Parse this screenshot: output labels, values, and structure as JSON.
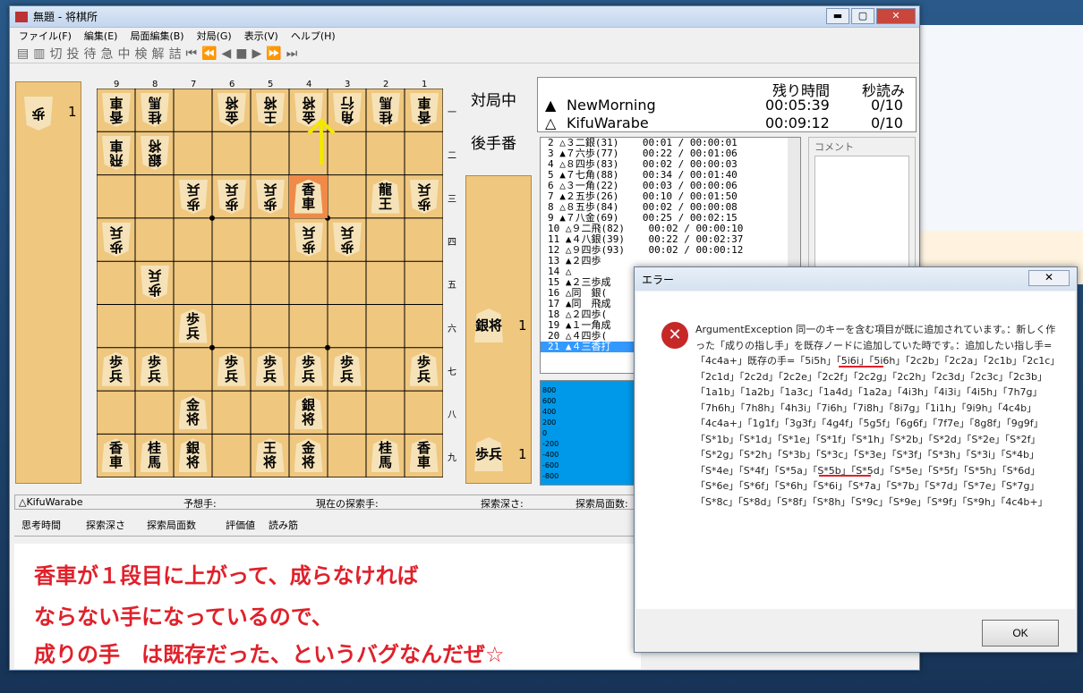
{
  "window": {
    "title": "無題 - 将棋所",
    "minimize": "▬",
    "maximize": "▢",
    "close": "✕"
  },
  "menu": [
    "ファイル(F)",
    "編集(E)",
    "局面編集(B)",
    "対局(G)",
    "表示(V)",
    "ヘルプ(H)"
  ],
  "toolbar": [
    "切",
    "投",
    "待",
    "急",
    "中",
    "検",
    "解",
    "詰",
    "⏮",
    "⏪",
    "◀",
    "■",
    "▶",
    "⏩",
    "⏭"
  ],
  "status_right": {
    "line1": "対局中",
    "line2": "後手番"
  },
  "gote_hand": [
    {
      "piece": "歩",
      "count": "1"
    }
  ],
  "sente_hand": [
    {
      "piece": "銀将",
      "count": "1"
    },
    {
      "piece": "歩兵",
      "count": "1"
    }
  ],
  "files": [
    "9",
    "8",
    "7",
    "6",
    "5",
    "4",
    "3",
    "2",
    "1"
  ],
  "ranks": [
    "一",
    "二",
    "三",
    "四",
    "五",
    "六",
    "七",
    "八",
    "九"
  ],
  "pieces": [
    {
      "c": 9,
      "r": 1,
      "t": "香車",
      "g": true
    },
    {
      "c": 8,
      "r": 1,
      "t": "桂馬",
      "g": true
    },
    {
      "c": 6,
      "r": 1,
      "t": "金将",
      "g": true
    },
    {
      "c": 5,
      "r": 1,
      "t": "王将",
      "g": true
    },
    {
      "c": 4,
      "r": 1,
      "t": "金将",
      "g": true
    },
    {
      "c": 3,
      "r": 1,
      "t": "角行",
      "g": true
    },
    {
      "c": 2,
      "r": 1,
      "t": "桂馬",
      "g": true
    },
    {
      "c": 1,
      "r": 1,
      "t": "香車",
      "g": true
    },
    {
      "c": 9,
      "r": 2,
      "t": "飛車",
      "g": true
    },
    {
      "c": 8,
      "r": 2,
      "t": "銀将",
      "g": true
    },
    {
      "c": 7,
      "r": 3,
      "t": "歩兵",
      "g": true
    },
    {
      "c": 6,
      "r": 3,
      "t": "歩兵",
      "g": true
    },
    {
      "c": 5,
      "r": 3,
      "t": "歩兵",
      "g": true
    },
    {
      "c": 4,
      "r": 3,
      "t": "香車",
      "g": false,
      "hl": true
    },
    {
      "c": 2,
      "r": 3,
      "t": "龍王",
      "g": false
    },
    {
      "c": 1,
      "r": 3,
      "t": "歩兵",
      "g": true
    },
    {
      "c": 9,
      "r": 4,
      "t": "歩兵",
      "g": true
    },
    {
      "c": 4,
      "r": 4,
      "t": "歩兵",
      "g": true
    },
    {
      "c": 3,
      "r": 4,
      "t": "歩兵",
      "g": true
    },
    {
      "c": 8,
      "r": 5,
      "t": "歩兵",
      "g": true
    },
    {
      "c": 7,
      "r": 6,
      "t": "歩兵",
      "g": false
    },
    {
      "c": 9,
      "r": 7,
      "t": "歩兵",
      "g": false
    },
    {
      "c": 8,
      "r": 7,
      "t": "歩兵",
      "g": false
    },
    {
      "c": 6,
      "r": 7,
      "t": "歩兵",
      "g": false
    },
    {
      "c": 5,
      "r": 7,
      "t": "歩兵",
      "g": false
    },
    {
      "c": 4,
      "r": 7,
      "t": "歩兵",
      "g": false
    },
    {
      "c": 3,
      "r": 7,
      "t": "歩兵",
      "g": false
    },
    {
      "c": 1,
      "r": 7,
      "t": "歩兵",
      "g": false
    },
    {
      "c": 7,
      "r": 8,
      "t": "金将",
      "g": false
    },
    {
      "c": 4,
      "r": 8,
      "t": "銀将",
      "g": false
    },
    {
      "c": 9,
      "r": 9,
      "t": "香車",
      "g": false
    },
    {
      "c": 8,
      "r": 9,
      "t": "桂馬",
      "g": false
    },
    {
      "c": 7,
      "r": 9,
      "t": "銀将",
      "g": false
    },
    {
      "c": 5,
      "r": 9,
      "t": "王将",
      "g": false
    },
    {
      "c": 4,
      "r": 9,
      "t": "金将",
      "g": false
    },
    {
      "c": 2,
      "r": 9,
      "t": "桂馬",
      "g": false
    },
    {
      "c": 1,
      "r": 9,
      "t": "香車",
      "g": false
    }
  ],
  "arrow_color": "#f2e800",
  "clock": {
    "h_remain": "残り時間",
    "h_byo": "秒読み",
    "p1": {
      "mark": "▲",
      "name": "NewMorning",
      "time": "00:05:39",
      "byo": "0/10"
    },
    "p2": {
      "mark": "△",
      "name": "KifuWarabe",
      "time": "00:09:12",
      "byo": "0/10"
    }
  },
  "kifu": [
    "2 △３二銀(31)    00:01 / 00:00:01",
    "3 ▲７六歩(77)    00:22 / 00:01:06",
    "4 △８四歩(83)    00:02 / 00:00:03",
    "5 ▲７七角(88)    00:34 / 00:01:40",
    "6 △３一角(22)    00:03 / 00:00:06",
    "7 ▲２五歩(26)    00:10 / 00:01:50",
    "8 △８五歩(84)    00:02 / 00:00:08",
    "9 ▲７八金(69)    00:25 / 00:02:15",
    "10 △９二飛(82)    00:02 / 00:00:10",
    "11 ▲４八銀(39)    00:22 / 00:02:37",
    "12 △９四歩(93)    00:02 / 00:00:12",
    "13 ▲２四歩",
    "14 △",
    "15 ▲２三歩成",
    "16 △同　銀(",
    "17 ▲同　飛成",
    "18 △２四歩(",
    "19 ▲１一角成",
    "20 △４四歩(",
    "21 ▲４三香打"
  ],
  "comment_label": "コメント",
  "eval_ticks": [
    "800",
    "600",
    "400",
    "200",
    "0",
    "-200",
    "-400",
    "-600",
    "-800"
  ],
  "status": {
    "player": "△KifuWarabe",
    "yosou": "予想手:",
    "current": "現在の探索手:",
    "depth": "探索深さ:",
    "nodes": "探索局面数:"
  },
  "think": {
    "time": "思考時間",
    "depth": "探索深さ",
    "nodes": "探索局面数",
    "eval": "評価値",
    "pv": "読み筋"
  },
  "memo": [
    "香車が１段目に上がって、成らなければ",
    "ならない手になっているので、",
    "成りの手　は既存だった、というバグなんだぜ☆"
  ],
  "dialog": {
    "title": "エラー",
    "close": "✕",
    "message": "ArgumentException 同一のキーを含む項目が既に追加されています。：新しく作った「成りの指し手」を既存ノードに追加していた時です。：追加したい指し手=「4c4a+」既存の手=「5i5h」「5i6i」「5i6h」「2c2b」「2c2a」「2c1b」「2c1c」「2c1d」「2c2d」「2c2e」「2c2f」「2c2g」「2c2h」「2c3d」「2c3c」「2c3b」「1a1b」「1a2b」「1a3c」「1a4d」「1a2a」「4i3h」「4i3i」「4i5h」「7h7g」「7h6h」「7h8h」「4h3i」「7i6h」「7i8h」「8i7g」「1i1h」「9i9h」「4c4b」「4c4a+」「1g1f」「3g3f」「4g4f」「5g5f」「6g6f」「7f7e」「8g8f」「9g9f」「S*1b」「S*1d」「S*1e」「S*1f」「S*1h」「S*2b」「S*2d」「S*2e」「S*2f」「S*2g」「S*2h」「S*3b」「S*3c」「S*3e」「S*3f」「S*3h」「S*3i」「S*4b」「S*4e」「S*4f」「S*5a」「S*5b」「S*5d」「S*5e」「S*5f」「S*5h」「S*6d」「S*6e」「S*6f」「S*6h」「S*6i」「S*7a」「S*7b」「S*7d」「S*7e」「S*7g」「S*8c」「S*8d」「S*8f」「S*8h」「S*9c」「S*9e」「S*9f」「S*9h」「4c4b+」",
    "ok": "OK"
  },
  "colors": {
    "board": "#efc77e",
    "highlight": "#f08a48",
    "memo": "#e0202a",
    "eval_bg": "#0099ea",
    "underline": "#e0202a"
  }
}
